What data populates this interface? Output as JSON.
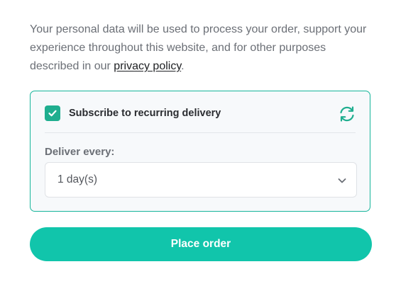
{
  "privacy": {
    "text_before": "Your personal data will be used to process your order, support your experience throughout this website, and for other purposes described in our ",
    "link_label": "privacy policy",
    "text_after": "."
  },
  "subscription": {
    "checkbox_checked": true,
    "label": "Subscribe to recurring delivery",
    "refresh_icon": "refresh-icon",
    "deliver_label": "Deliver every:",
    "frequency_value": "1 day(s)"
  },
  "actions": {
    "place_order_label": "Place order"
  },
  "colors": {
    "accent": "#11c5ab",
    "checkbox": "#1fae8f",
    "border": "#16b59a",
    "box_background": "#f7f9fb"
  }
}
